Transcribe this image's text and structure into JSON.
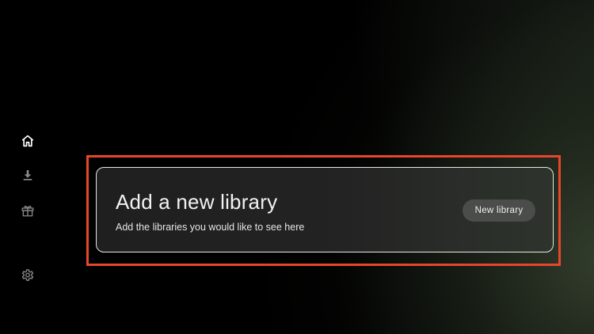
{
  "sidebar": {
    "items": [
      {
        "icon": "home-icon"
      },
      {
        "icon": "download-icon"
      },
      {
        "icon": "gift-icon"
      },
      {
        "icon": "gear-icon"
      }
    ]
  },
  "library_card": {
    "title": "Add a new library",
    "subtitle": "Add the libraries you would like to see here",
    "button_label": "New library"
  },
  "colors": {
    "background": "#000000",
    "highlight_border": "#e8462b",
    "card_border": "#e8e8e8",
    "button_bg": "#4a4d49",
    "text": "#f2f2f2"
  }
}
